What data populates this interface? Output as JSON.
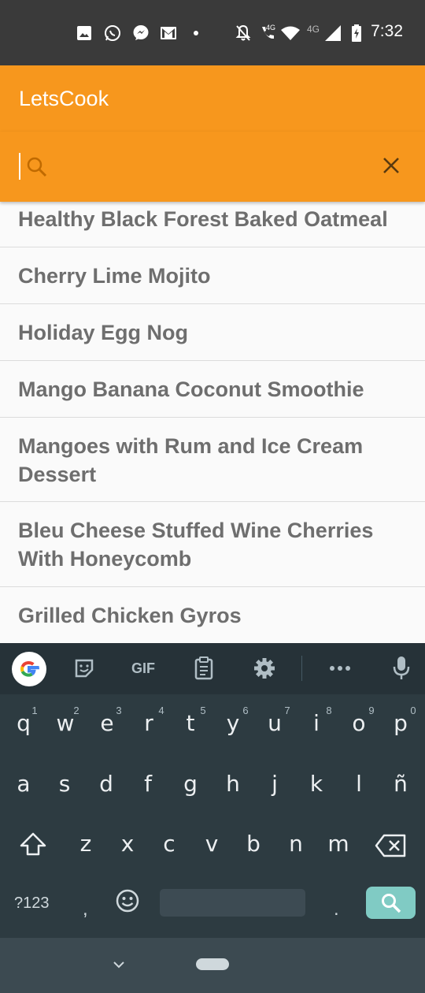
{
  "status_bar": {
    "time": "7:32",
    "net_label_1": "4G",
    "net_label_2": "4G",
    "icons": [
      "image-icon",
      "whatsapp-icon",
      "messenger-icon",
      "gmail-icon",
      "dot-icon",
      "notifications-off-icon",
      "volte-call-icon",
      "wifi-icon",
      "signal-icon",
      "battery-charging-icon"
    ]
  },
  "app_bar": {
    "title": "LetsCook"
  },
  "search": {
    "value": "",
    "placeholder": "",
    "icon": "search-icon",
    "clear_icon": "close-icon"
  },
  "recipes": [
    {
      "title": "Healthy Black Forest Baked Oatmeal"
    },
    {
      "title": "Cherry Lime Mojito"
    },
    {
      "title": "Holiday Egg Nog"
    },
    {
      "title": "Mango Banana Coconut Smoothie"
    },
    {
      "title": "Mangoes with Rum and Ice Cream Dessert"
    },
    {
      "title": "Bleu Cheese Stuffed Wine Cherries With Honeycomb"
    },
    {
      "title": "Grilled Chicken Gyros"
    }
  ],
  "keyboard": {
    "toolbar": {
      "gif_label": "GIF"
    },
    "row1": [
      {
        "key": "q",
        "hint": "1"
      },
      {
        "key": "w",
        "hint": "2"
      },
      {
        "key": "e",
        "hint": "3"
      },
      {
        "key": "r",
        "hint": "4"
      },
      {
        "key": "t",
        "hint": "5"
      },
      {
        "key": "y",
        "hint": "6"
      },
      {
        "key": "u",
        "hint": "7"
      },
      {
        "key": "i",
        "hint": "8"
      },
      {
        "key": "o",
        "hint": "9"
      },
      {
        "key": "p",
        "hint": "0"
      }
    ],
    "row2": [
      "a",
      "s",
      "d",
      "f",
      "g",
      "h",
      "j",
      "k",
      "l",
      "ñ"
    ],
    "row3": [
      "z",
      "x",
      "c",
      "v",
      "b",
      "n",
      "m"
    ],
    "symbols_label": "?123",
    "comma": ",",
    "period": "."
  },
  "colors": {
    "accent": "#f7971d",
    "status_bar": "#3a3a3a",
    "list_text": "#6e6e6e",
    "keyboard_bg": "#263238",
    "search_key": "#80cbc4"
  }
}
